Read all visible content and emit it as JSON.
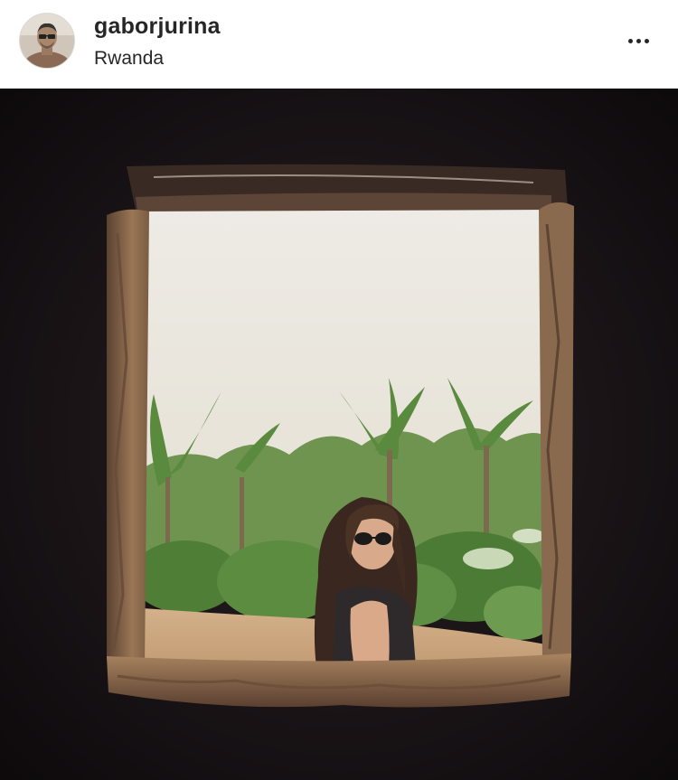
{
  "post": {
    "username": "gaborjurina",
    "location": "Rwanda",
    "more_icon": "more-horizontal-icon",
    "avatar_icon": "avatar-photo"
  },
  "photo": {
    "subject": "woman-in-sunglasses-through-mud-wall-window",
    "colors": {
      "wall_dark": "#141012",
      "window_frame": "#8a6a4e",
      "sky": "#ece9e2",
      "foliage": "#5f8a48",
      "ground": "#c9a47e"
    }
  }
}
